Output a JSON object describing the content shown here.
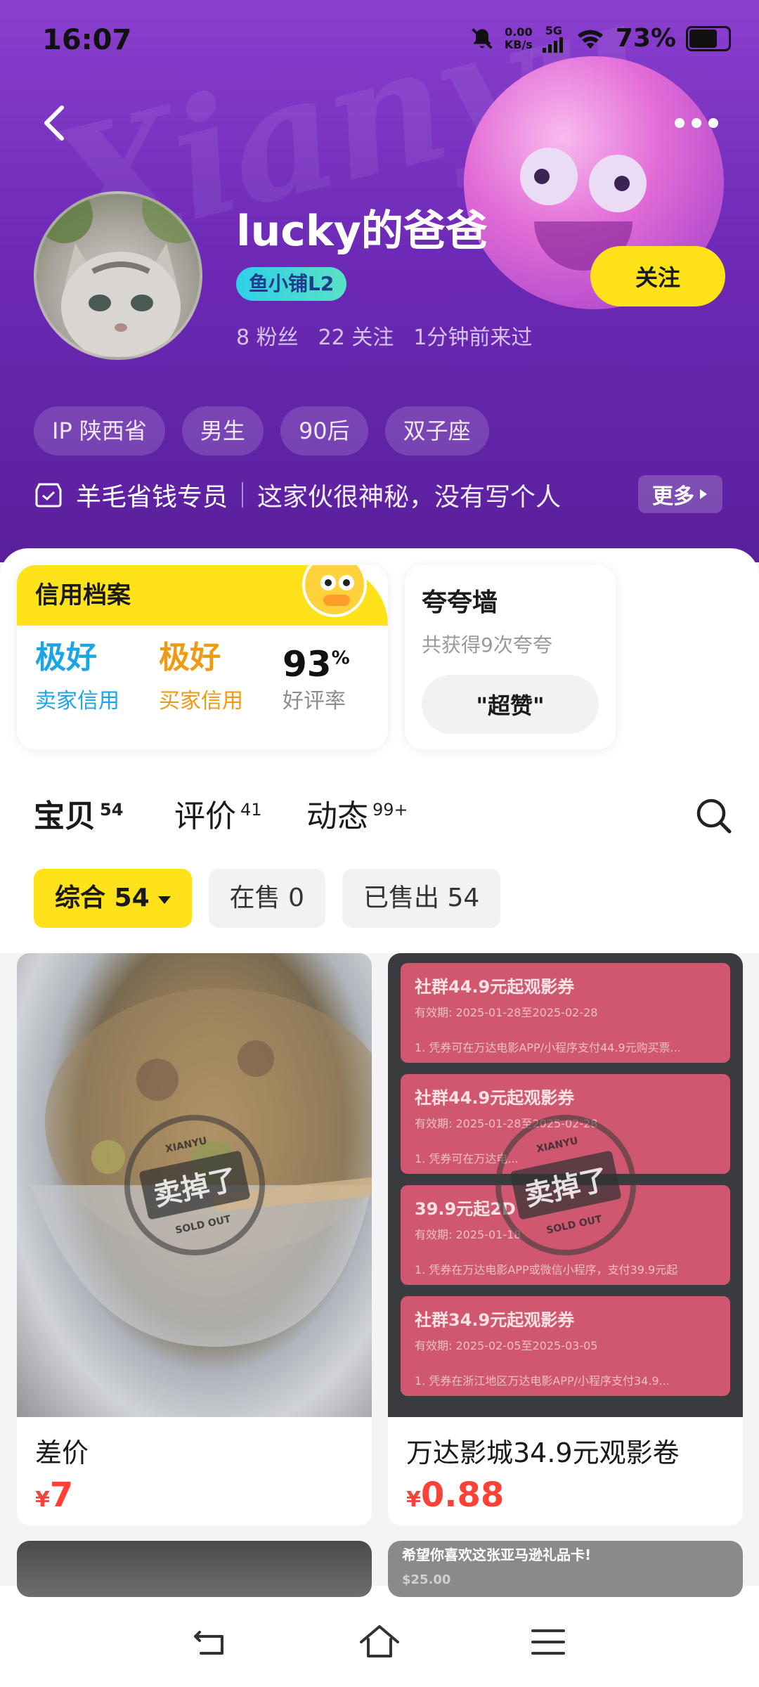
{
  "status_bar": {
    "time": "16:07",
    "net_speed_value": "0.00",
    "net_speed_unit": "KB/s",
    "network": "5G",
    "battery": "73%",
    "battery_level": 0.73
  },
  "profile": {
    "name": "lucky的爸爸",
    "badge": "鱼小铺L2",
    "fans": "8 粉丝",
    "following": "22 关注",
    "last_seen": "1分钟前来过",
    "follow_label": "关注",
    "tags": [
      "IP 陕西省",
      "男生",
      "90后",
      "双子座"
    ],
    "title": "羊毛省钱专员",
    "bio": "这家伙很神秘，没有写个人",
    "more_label": "更多"
  },
  "credit": {
    "title": "信用档案",
    "seller_value": "极好",
    "seller_label": "卖家信用",
    "buyer_value": "极好",
    "buyer_label": "买家信用",
    "rating_value": "93",
    "rating_unit": "%",
    "rating_label": "好评率"
  },
  "kudos": {
    "title": "夸夸墙",
    "subtitle": "共获得9次夸夸",
    "chip": "\"超赞\""
  },
  "tabs": [
    {
      "label": "宝贝",
      "count": "54"
    },
    {
      "label": "评价",
      "count": "41"
    },
    {
      "label": "动态",
      "count": "99+"
    }
  ],
  "filters": [
    {
      "label": "综合 54"
    },
    {
      "label": "在售 0"
    },
    {
      "label": "已售出 54"
    }
  ],
  "listings": [
    {
      "title": "差价",
      "currency": "¥",
      "price": "7",
      "stamp": "卖掉了",
      "stamp_top": "XIANYU",
      "stamp_bottom": "SOLD OUT"
    },
    {
      "title": "万达影城34.9元观影卷",
      "currency": "¥",
      "price": "0.88",
      "stamp": "卖掉了",
      "stamp_top": "XIANYU",
      "stamp_bottom": "SOLD OUT",
      "tickets": [
        {
          "title": "社群44.9元起观影券",
          "date": "有效期: 2025-01-28至2025-02-28",
          "line": "1. 凭券可在万达电影APP/小程序支付44.9元购买票..."
        },
        {
          "title": "社群44.9元起观影券",
          "date": "有效期: 2025-01-28至2025-02-28",
          "line": "1. 凭券可在万达电..."
        },
        {
          "title": "39.9元起2D",
          "date": "有效期: 2025-01-18",
          "line": "1. 凭券在万达电影APP或微信小程序，支付39.9元起"
        },
        {
          "title": "社群34.9元起观影券",
          "date": "有效期: 2025-02-05至2025-03-05",
          "line": "1. 凭券在浙江地区万达电影APP/小程序支付34.9..."
        }
      ]
    }
  ],
  "partial_listings": [
    {
      "text": ""
    },
    {
      "text": "希望你喜欢这张亚马逊礼品卡!",
      "sub": "$25.00"
    }
  ]
}
